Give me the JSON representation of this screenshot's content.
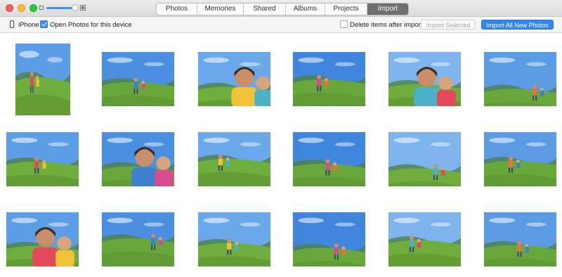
{
  "tabs": [
    {
      "label": "Photos",
      "active": false
    },
    {
      "label": "Memories",
      "active": false
    },
    {
      "label": "Shared",
      "active": false
    },
    {
      "label": "Albums",
      "active": false
    },
    {
      "label": "Projects",
      "active": false
    },
    {
      "label": "Import",
      "active": true
    }
  ],
  "import_bar": {
    "device_name": "iPhone",
    "open_photos_label": "Open Photos for this device",
    "open_photos_checked": true,
    "delete_label": "Delete items after import",
    "delete_checked": false,
    "import_selected_label": "Import Selected",
    "import_all_label": "Import All New Photos"
  },
  "colors": {
    "accent": "#2f86f6",
    "active_tab": "#6f6f6f"
  },
  "photos": [
    {
      "subject": "hiking family portrait"
    },
    {
      "subject": "wide meadow with hikers"
    },
    {
      "subject": "smiling girl with braids"
    },
    {
      "subject": "green field landscape"
    },
    {
      "subject": "kids with backpacks"
    },
    {
      "subject": "children on hillside"
    },
    {
      "subject": "hillside trail hikers"
    },
    {
      "subject": "mother and daughter selfie"
    },
    {
      "subject": "valley panorama"
    },
    {
      "subject": "family walking uphill"
    },
    {
      "subject": "trail through meadow"
    },
    {
      "subject": "girl in red jacket"
    },
    {
      "subject": "family group smiling"
    },
    {
      "subject": "walkers on ridge"
    },
    {
      "subject": "mother and daughter in field"
    },
    {
      "subject": "couple embracing"
    },
    {
      "subject": "girl on grassy slope"
    },
    {
      "subject": "father with children"
    }
  ]
}
